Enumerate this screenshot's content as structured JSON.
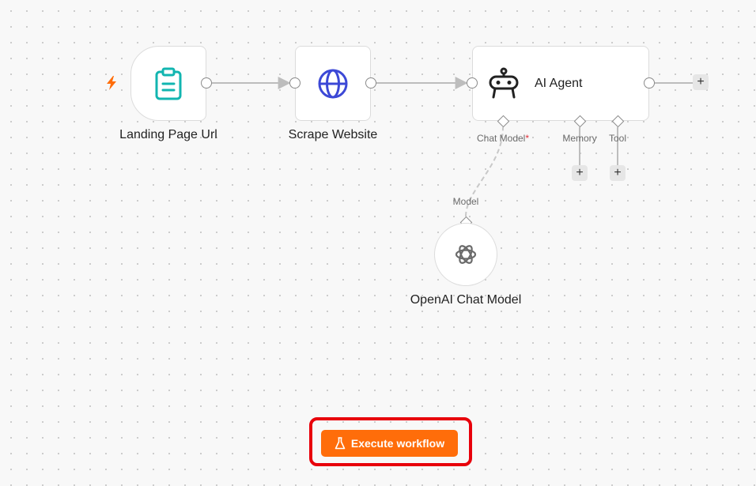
{
  "nodes": {
    "trigger": {
      "title": "Landing Page Url",
      "icon": "clipboard-icon",
      "icon_color": "#12b5b0"
    },
    "scrape": {
      "title": "Scrape Website",
      "icon": "globe-icon",
      "icon_color": "#3c48d6"
    },
    "agent": {
      "title": "AI Agent",
      "icon": "robot-icon",
      "ports": {
        "chat_model": "Chat Model",
        "required_mark": "*",
        "memory": "Memory",
        "tool": "Tool"
      }
    },
    "openai": {
      "title": "OpenAI Chat Model",
      "icon": "openai-icon",
      "port_label": "Model"
    }
  },
  "add_buttons": {
    "label": "+"
  },
  "toolbar": {
    "execute_label": "Execute workflow",
    "execute_icon": "flask-icon",
    "execute_color": "#ff6d0a"
  },
  "trigger_icon": "lightning-icon",
  "trigger_icon_color": "#ff6d0a",
  "highlight_color": "#e8000b"
}
